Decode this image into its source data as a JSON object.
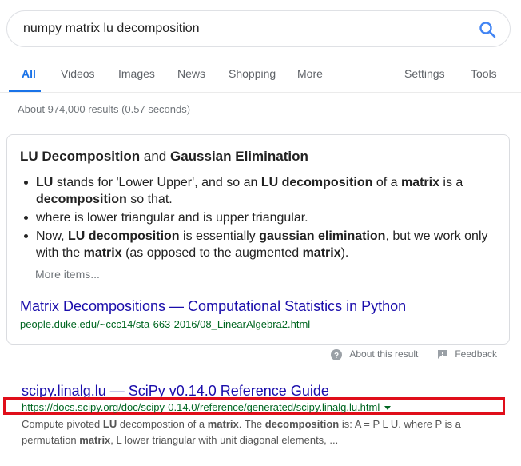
{
  "search": {
    "query": "numpy matrix lu decomposition",
    "accent_color": "#1a73e8"
  },
  "tabs": {
    "items": [
      {
        "label": "All",
        "active": true
      },
      {
        "label": "Videos"
      },
      {
        "label": "Images"
      },
      {
        "label": "News"
      },
      {
        "label": "Shopping"
      },
      {
        "label": "More"
      }
    ],
    "settings": "Settings",
    "tools": "Tools"
  },
  "stats": "About 974,000 results (0.57 seconds)",
  "featured": {
    "title_part1": "LU Decomposition",
    "title_and": " and ",
    "title_part2": "Gaussian Elimination",
    "bullets": [
      [
        {
          "t": "LU",
          "b": true
        },
        {
          "t": " stands for 'Lower Upper', and so an "
        },
        {
          "t": "LU decomposition",
          "b": true
        },
        {
          "t": " of a "
        },
        {
          "t": "matrix",
          "b": true
        },
        {
          "t": " is a "
        },
        {
          "t": "decomposition",
          "b": true
        },
        {
          "t": " so that."
        }
      ],
      [
        {
          "t": "where is lower triangular and is upper triangular."
        }
      ],
      [
        {
          "t": "Now, "
        },
        {
          "t": "LU decomposition",
          "b": true
        },
        {
          "t": " is essentially "
        },
        {
          "t": "gaussian elimination",
          "b": true
        },
        {
          "t": ", but we work only with the "
        },
        {
          "t": "matrix",
          "b": true
        },
        {
          "t": " (as opposed to the augmented "
        },
        {
          "t": "matrix",
          "b": true
        },
        {
          "t": ")."
        }
      ]
    ],
    "more_items": "More items...",
    "link_title": "Matrix Decompositions — Computational Statistics in Python",
    "link_url": "people.duke.edu/~ccc14/sta-663-2016/08_LinearAlgebra2.html"
  },
  "about": {
    "about_label": "About this result",
    "feedback_label": "Feedback"
  },
  "result": {
    "title": "scipy.linalg.lu — SciPy v0.14.0 Reference Guide",
    "url": "https://docs.scipy.org/doc/scipy-0.14.0/reference/generated/scipy.linalg.lu.html",
    "snippet": [
      {
        "t": "Compute pivoted "
      },
      {
        "t": "LU",
        "b": true
      },
      {
        "t": " decompostion of a "
      },
      {
        "t": "matrix",
        "b": true
      },
      {
        "t": ". The "
      },
      {
        "t": "decomposition",
        "b": true
      },
      {
        "t": " is: A = P L U. where P is a permutation "
      },
      {
        "t": "matrix",
        "b": true
      },
      {
        "t": ", L lower triangular with unit diagonal elements, ..."
      }
    ],
    "highlight_color": "#e00e1a"
  }
}
